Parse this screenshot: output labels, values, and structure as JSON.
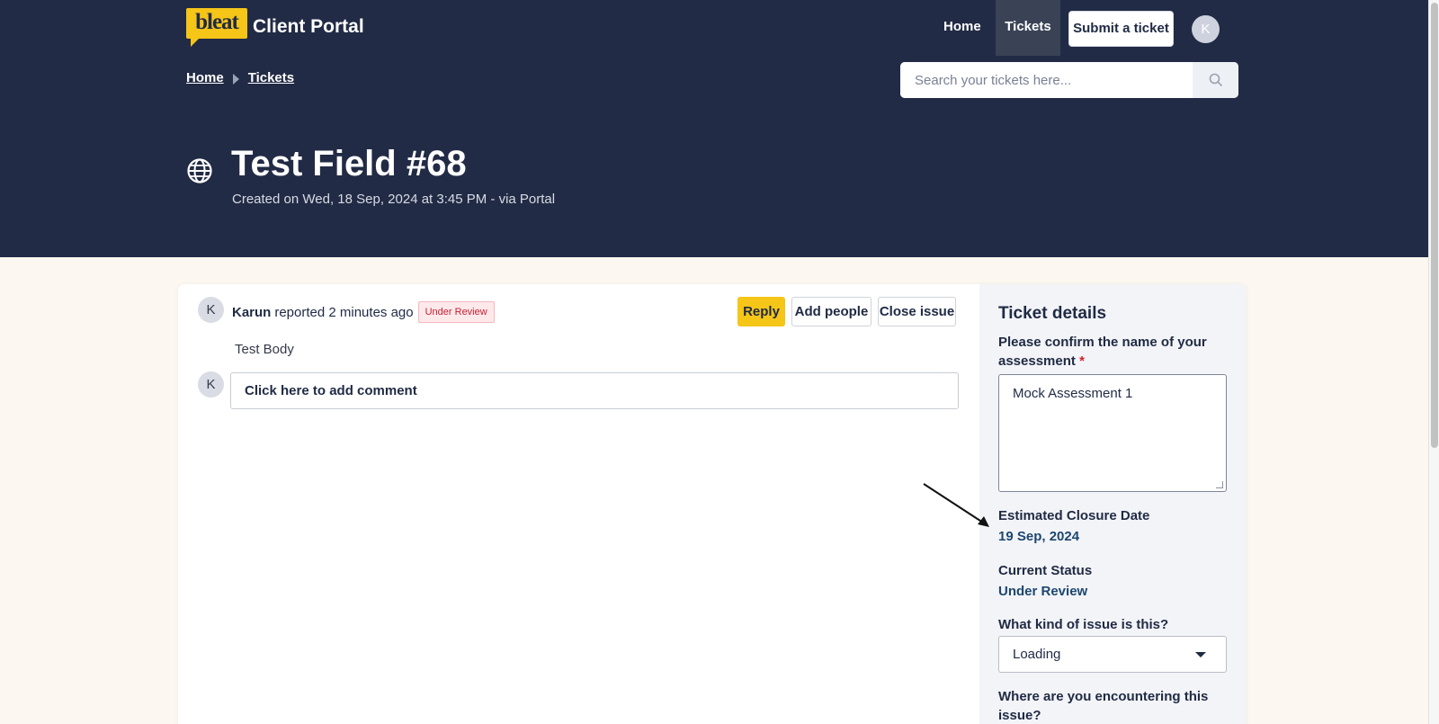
{
  "header": {
    "logo_text": "bleat",
    "portal_name": "Client Portal",
    "nav": {
      "home": "Home",
      "tickets": "Tickets",
      "submit": "Submit a ticket",
      "avatar_initial": "K"
    },
    "breadcrumb": [
      "Home",
      "Tickets"
    ],
    "search": {
      "placeholder": "Search your tickets here...",
      "value": ""
    }
  },
  "ticket": {
    "title": "Test Field #68",
    "created": "Created on Wed, 18 Sep, 2024 at 3:45 PM - via Portal",
    "icon": "globe-icon"
  },
  "thread": {
    "reporter_initial": "K",
    "reporter_name": "Karun",
    "reported_text": "reported 2 minutes ago",
    "status_badge": "Under Review",
    "actions": {
      "reply": "Reply",
      "add_people": "Add people",
      "close": "Close issue"
    },
    "body": "Test Body",
    "commenter_initial": "K",
    "comment_placeholder": "Click here to add comment"
  },
  "details": {
    "heading": "Ticket details",
    "assessment_label": "Please confirm the name of your assessment",
    "assessment_value": "Mock Assessment 1",
    "closure_label": "Estimated Closure Date",
    "closure_value": "19 Sep, 2024",
    "status_label": "Current Status",
    "status_value": "Under Review",
    "issue_kind_label": "What kind of issue is this?",
    "issue_kind_value": "Loading",
    "location_label": "Where are you encountering this issue?",
    "required_marker": "*"
  },
  "colors": {
    "header_bg": "#222b45",
    "accent": "#f5c518",
    "badge": "#c61f33",
    "link_value": "#1d4770"
  }
}
